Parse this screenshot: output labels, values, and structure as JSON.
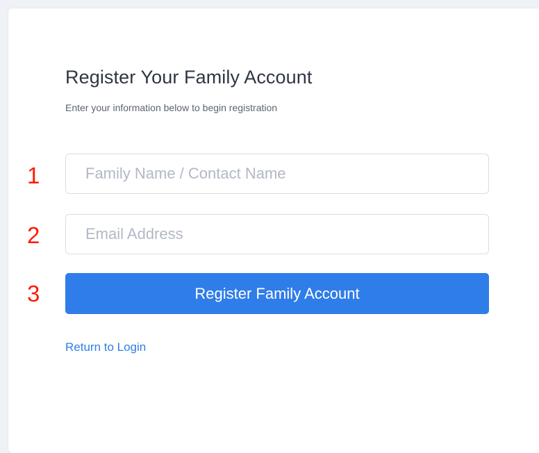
{
  "form": {
    "title": "Register Your Family Account",
    "subtitle": "Enter your information below to begin registration",
    "name_placeholder": "Family Name / Contact Name",
    "name_value": "",
    "email_placeholder": "Email Address",
    "email_value": "",
    "submit_label": "Register Family Account",
    "return_link": "Return to Login"
  },
  "annotations": {
    "marker_1": "1",
    "marker_2": "2",
    "marker_3": "3"
  },
  "colors": {
    "accent": "#2f7de8",
    "marker": "#ff1a00",
    "background": "#eef1f6"
  }
}
